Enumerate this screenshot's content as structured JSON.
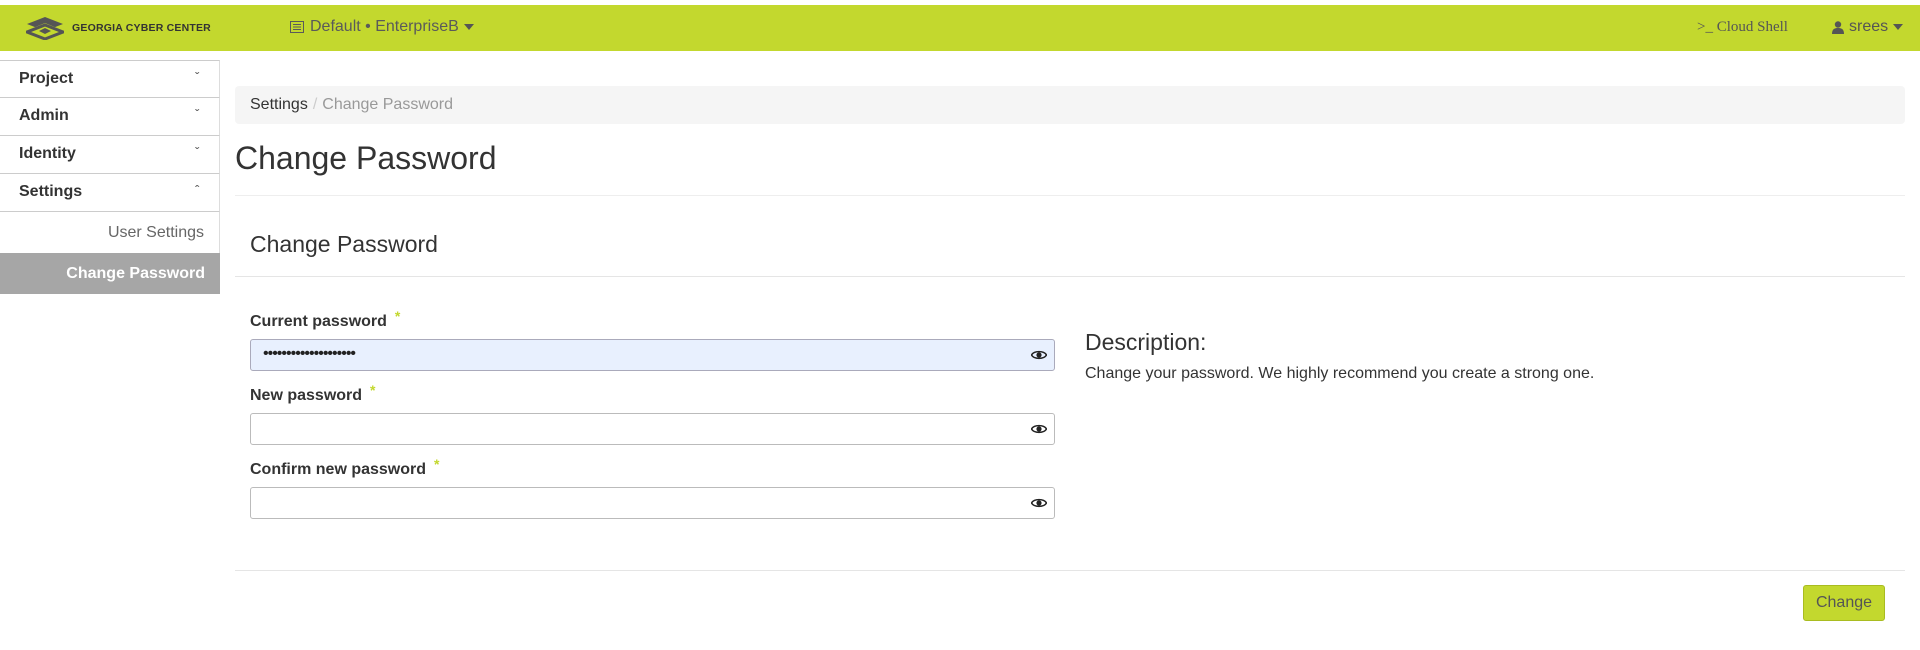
{
  "header": {
    "brand": "GEORGIA CYBER CENTER",
    "project_picker": "Default • EnterpriseB",
    "cloud_shell": ">_ Cloud Shell",
    "user": "srees"
  },
  "sidebar": {
    "items": [
      {
        "label": "Project",
        "chevron": "ˇ"
      },
      {
        "label": "Admin",
        "chevron": "ˇ"
      },
      {
        "label": "Identity",
        "chevron": "ˇ"
      },
      {
        "label": "Settings",
        "chevron": "ˆ"
      }
    ],
    "sub_items": [
      {
        "label": "User Settings"
      },
      {
        "label": "Change Password",
        "active": true
      }
    ]
  },
  "breadcrumb": {
    "parent": "Settings",
    "separator": "/",
    "current": "Change Password"
  },
  "page": {
    "title": "Change Password",
    "panel_title": "Change Password"
  },
  "form": {
    "required_marker": "*",
    "fields": [
      {
        "label": "Current password",
        "value": "••••••••••••••••••••"
      },
      {
        "label": "New password",
        "value": ""
      },
      {
        "label": "Confirm new password",
        "value": ""
      }
    ]
  },
  "description": {
    "title": "Description:",
    "text": "Change your password. We highly recommend you create a strong one."
  },
  "actions": {
    "submit_label": "Change"
  },
  "colors": {
    "accent": "#c3d82e",
    "active_nav": "#a6a6a6",
    "autofill": "#e8f0fe"
  },
  "icons": [
    "gcc-logo-icon",
    "project-list-icon",
    "caret-down-icon",
    "user-icon",
    "eye-icon",
    "chevron-down-icon",
    "chevron-up-icon"
  ]
}
